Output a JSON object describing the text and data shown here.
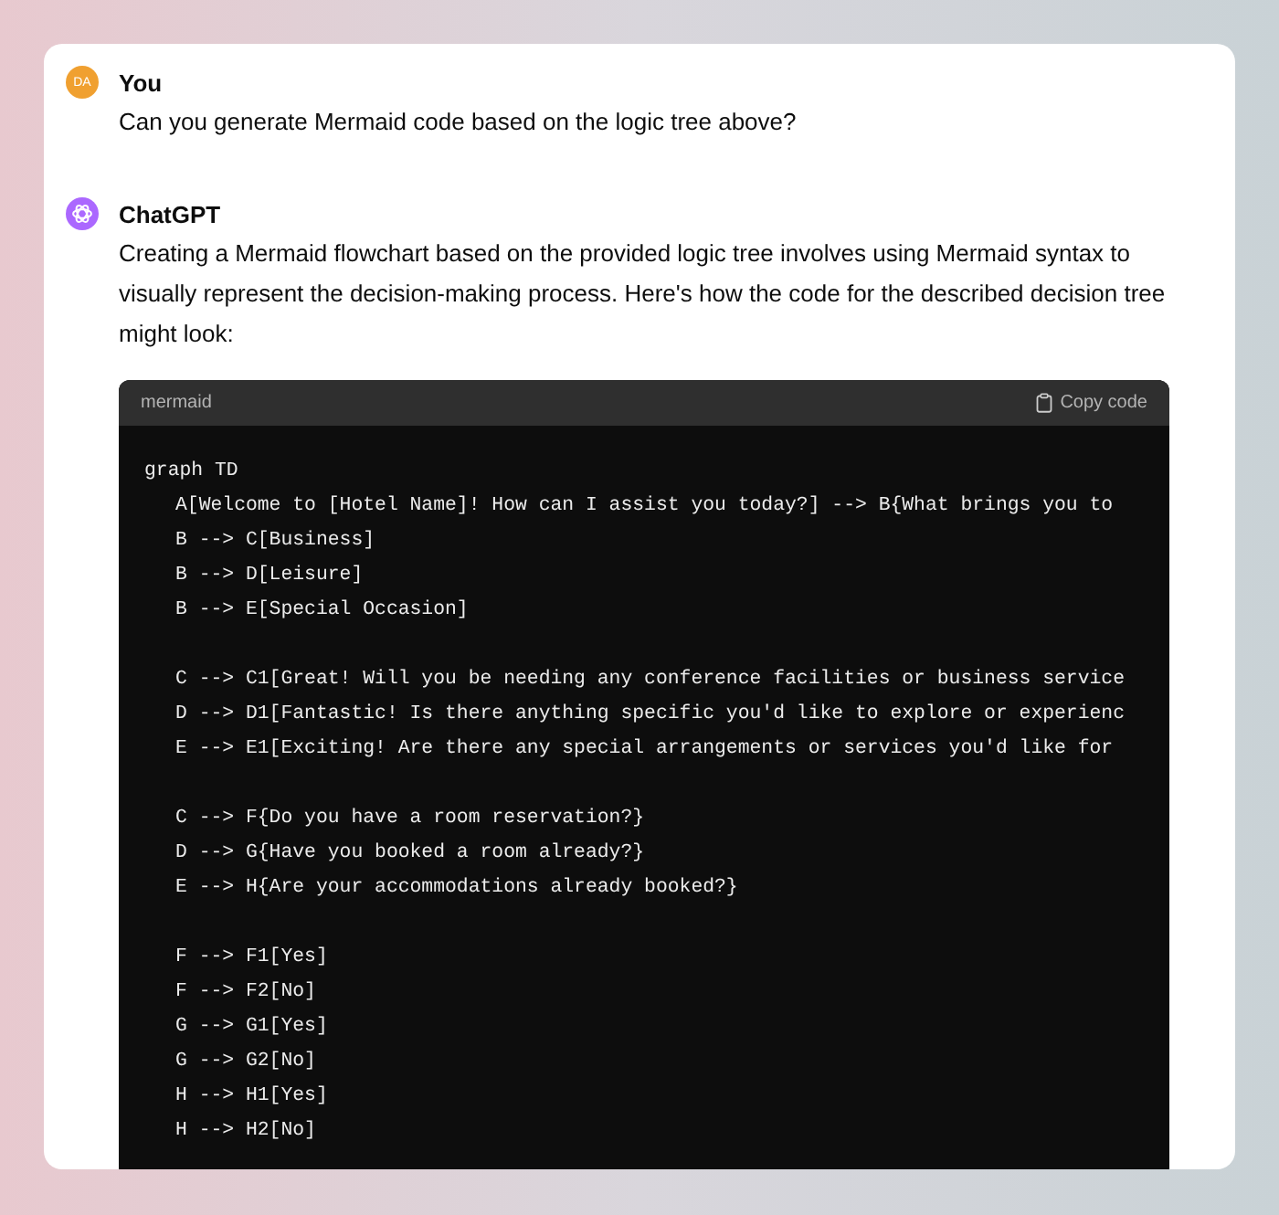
{
  "messages": [
    {
      "author": "You",
      "avatar_initials": "DA",
      "kind": "user",
      "text": "Can you generate Mermaid code based on the logic tree above?"
    },
    {
      "author": "ChatGPT",
      "kind": "assistant",
      "text": "Creating a Mermaid flowchart based on the provided logic tree involves using Mermaid syntax to visually represent the decision-making process. Here's how the code for the described decision tree might look:",
      "code_block": {
        "language": "mermaid",
        "copy_label": "Copy code",
        "header_line": "graph TD",
        "groups": [
          [
            "A[Welcome to [Hotel Name]! How can I assist you today?] --> B{What brings you to",
            "B --> C[Business]",
            "B --> D[Leisure]",
            "B --> E[Special Occasion]"
          ],
          [
            "C --> C1[Great! Will you be needing any conference facilities or business service",
            "D --> D1[Fantastic! Is there anything specific you'd like to explore or experienc",
            "E --> E1[Exciting! Are there any special arrangements or services you'd like for"
          ],
          [
            "C --> F{Do you have a room reservation?}",
            "D --> G{Have you booked a room already?}",
            "E --> H{Are your accommodations already booked?}"
          ],
          [
            "F --> F1[Yes]",
            "F --> F2[No]",
            "G --> G1[Yes]",
            "G --> G2[No]",
            "H --> H1[Yes]",
            "H --> H2[No]"
          ]
        ]
      }
    }
  ]
}
